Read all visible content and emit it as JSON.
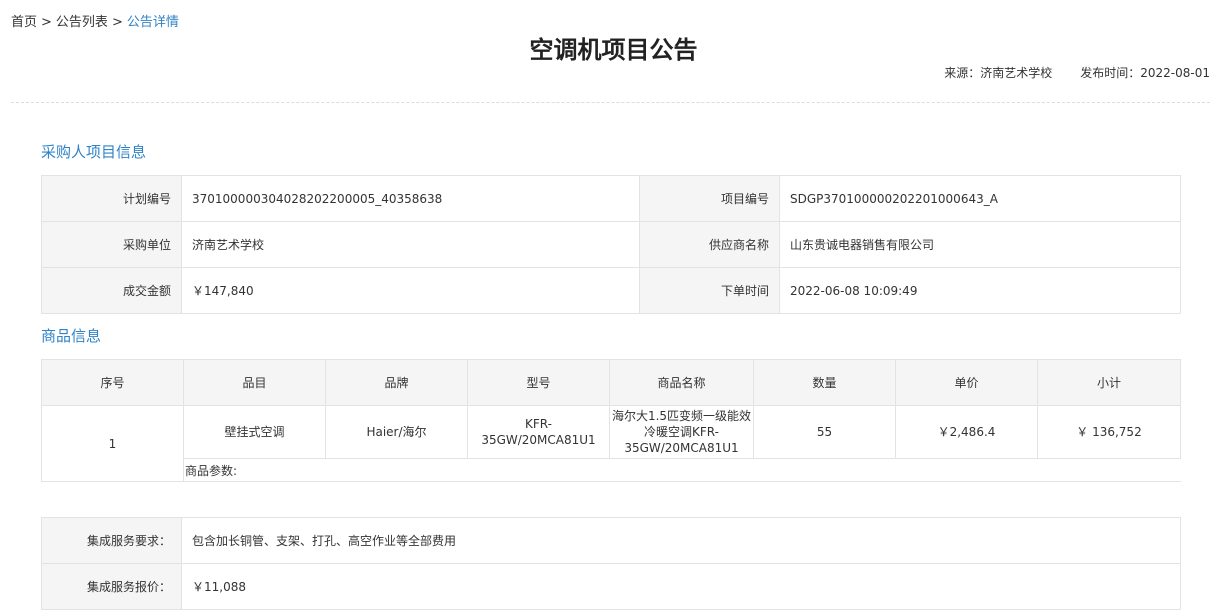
{
  "breadcrumb": {
    "home": "首页",
    "separator": ">",
    "list": "公告列表",
    "current": "公告详情"
  },
  "page_title": "空调机项目公告",
  "meta": {
    "source": "来源：济南艺术学校",
    "publish_time": "发布时间：2022-08-01"
  },
  "purchaser_section": {
    "title": "采购人项目信息",
    "rows": [
      {
        "l1": "计划编号",
        "v1": "370100000304028202200005_40358638",
        "l2": "项目编号",
        "v2": "SDGP370100000202201000643_A"
      },
      {
        "l1": "采购单位",
        "v1": "济南艺术学校",
        "l2": "供应商名称",
        "v2": "山东贵诚电器销售有限公司"
      },
      {
        "l1": "成交金额",
        "v1": "￥147,840",
        "l2": "下单时间",
        "v2": "2022-06-08 10:09:49"
      }
    ]
  },
  "goods_section": {
    "title": "商品信息",
    "headers": [
      "序号",
      "品目",
      "品牌",
      "型号",
      "商品名称",
      "数量",
      "单价",
      "小计"
    ],
    "row": {
      "index": "1",
      "category": "壁挂式空调",
      "brand": "Haier/海尔",
      "model": "KFR-35GW/20MCA81U1",
      "name": "海尔大1.5匹变频一级能效冷暖空调KFR-35GW/20MCA81U1",
      "qty": "55",
      "unit_price": "￥2,486.4",
      "subtotal": "￥ 136,752"
    },
    "params_label": "商品参数:"
  },
  "service_section": {
    "rows": [
      {
        "label": "集成服务要求：",
        "value": "包含加长铜管、支架、打孔、高空作业等全部费用"
      },
      {
        "label": "集成服务报价：",
        "value": "￥11,088"
      }
    ]
  },
  "colors": {
    "accent": "#2f83c8",
    "label_bg": "#f5f5f5",
    "border": "#e3e3e3"
  }
}
